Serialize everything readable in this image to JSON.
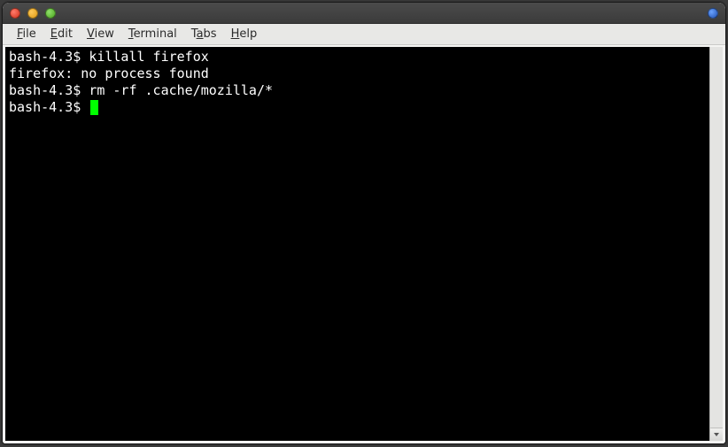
{
  "menubar": {
    "items": [
      {
        "label": "File",
        "mnemonic": "F"
      },
      {
        "label": "Edit",
        "mnemonic": "E"
      },
      {
        "label": "View",
        "mnemonic": "V"
      },
      {
        "label": "Terminal",
        "mnemonic": "T"
      },
      {
        "label": "Tabs",
        "mnemonic": "a"
      },
      {
        "label": "Help",
        "mnemonic": "H"
      }
    ]
  },
  "terminal": {
    "prompt": "bash-4.3$ ",
    "lines": [
      {
        "prompt": "bash-4.3$ ",
        "text": "killall firefox"
      },
      {
        "prompt": "",
        "text": "firefox: no process found"
      },
      {
        "prompt": "bash-4.3$ ",
        "text": "rm -rf .cache/mozilla/*"
      },
      {
        "prompt": "bash-4.3$ ",
        "text": "",
        "cursor": true
      }
    ]
  }
}
